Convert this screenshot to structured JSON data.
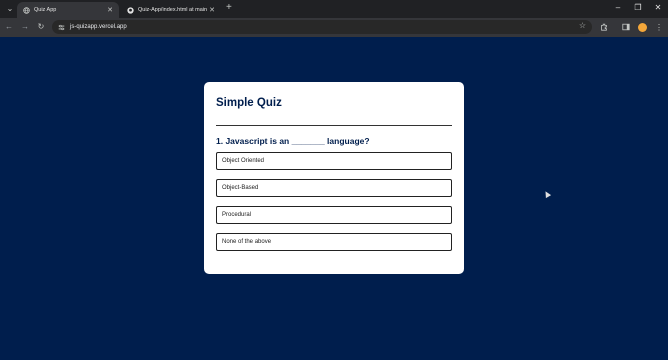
{
  "browser": {
    "tabs": [
      {
        "title": "Quiz App",
        "icon": "globe-icon",
        "active": true
      },
      {
        "title": "Quiz-App/index.html at main ·",
        "icon": "github-icon",
        "active": false
      }
    ],
    "url": "js-quizapp.vercel.app"
  },
  "quiz": {
    "title": "Simple Quiz",
    "question": "1. Javascript is an _______ language?",
    "answers": [
      "Object Oriented",
      "Object-Based",
      "Procedural",
      "None of the above"
    ]
  },
  "colors": {
    "background": "#001e4d",
    "card": "#ffffff",
    "heading": "#001e4d"
  }
}
